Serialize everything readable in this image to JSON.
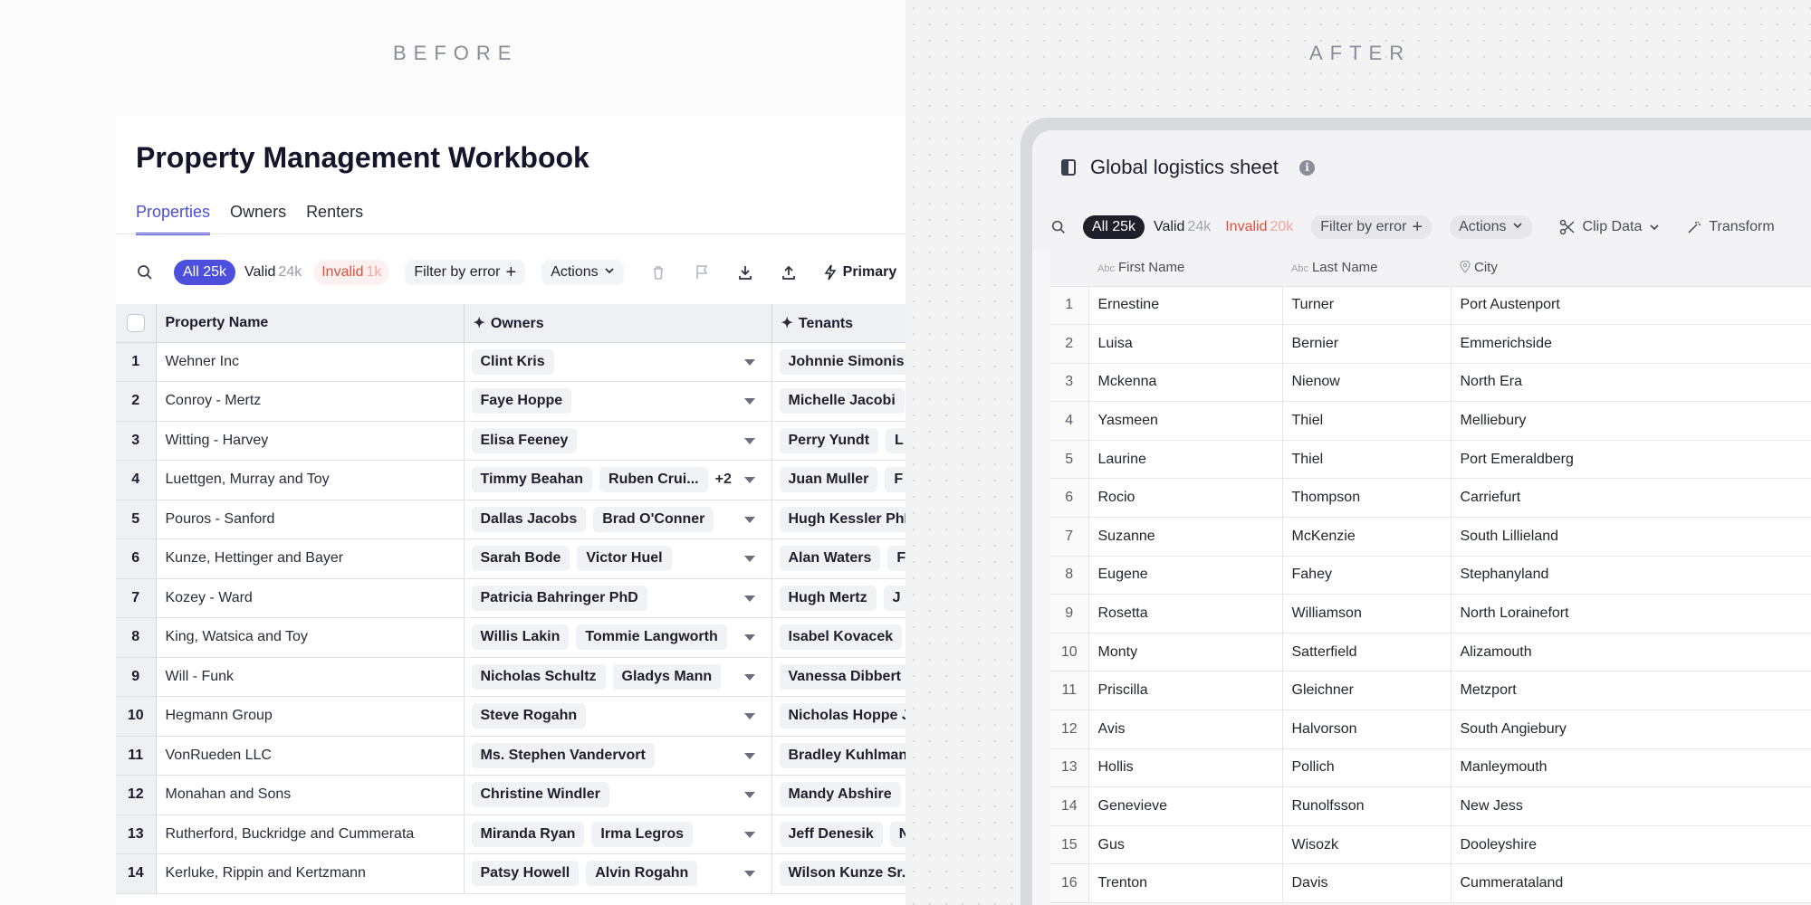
{
  "labels": {
    "before": "BEFORE",
    "after": "AFTER"
  },
  "before": {
    "title": "Property Management Workbook",
    "tabs": [
      {
        "label": "Properties",
        "active": true
      },
      {
        "label": "Owners",
        "active": false
      },
      {
        "label": "Renters",
        "active": false
      }
    ],
    "toolbar": {
      "all_label": "All",
      "all_count": "25k",
      "valid_label": "Valid",
      "valid_count": "24k",
      "invalid_label": "Invalid",
      "invalid_count": "1k",
      "filter_label": "Filter by error",
      "actions_label": "Actions",
      "primary_label": "Primary"
    },
    "columns": [
      "Property Name",
      "Owners",
      "Tenants"
    ],
    "rows": [
      {
        "num": "1",
        "name": "Wehner Inc",
        "owners": [
          "Clint Kris"
        ],
        "more": "",
        "tenants": [
          "Johnnie Simonis"
        ]
      },
      {
        "num": "2",
        "name": "Conroy - Mertz",
        "owners": [
          "Faye Hoppe"
        ],
        "more": "",
        "tenants": [
          "Michelle Jacobi"
        ]
      },
      {
        "num": "3",
        "name": "Witting - Harvey",
        "owners": [
          "Elisa Feeney"
        ],
        "more": "",
        "tenants": [
          "Perry Yundt",
          "L"
        ]
      },
      {
        "num": "4",
        "name": "Luettgen, Murray and Toy",
        "owners": [
          "Timmy Beahan",
          "Ruben Crui..."
        ],
        "more": "+2",
        "tenants": [
          "Juan Muller",
          "F"
        ]
      },
      {
        "num": "5",
        "name": "Pouros - Sanford",
        "owners": [
          "Dallas Jacobs",
          "Brad O'Conner"
        ],
        "more": "",
        "tenants": [
          "Hugh Kessler PhD"
        ]
      },
      {
        "num": "6",
        "name": "Kunze, Hettinger and Bayer",
        "owners": [
          "Sarah Bode",
          "Victor Huel"
        ],
        "more": "",
        "tenants": [
          "Alan Waters",
          "F"
        ]
      },
      {
        "num": "7",
        "name": "Kozey - Ward",
        "owners": [
          "Patricia Bahringer PhD"
        ],
        "more": "",
        "tenants": [
          "Hugh Mertz",
          "J"
        ]
      },
      {
        "num": "8",
        "name": "King, Watsica and Toy",
        "owners": [
          "Willis Lakin",
          "Tommie Langworth"
        ],
        "more": "",
        "tenants": [
          "Isabel Kovacek"
        ]
      },
      {
        "num": "9",
        "name": "Will - Funk",
        "owners": [
          "Nicholas Schultz",
          "Gladys Mann"
        ],
        "more": "",
        "tenants": [
          "Vanessa Dibbert"
        ]
      },
      {
        "num": "10",
        "name": "Hegmann Group",
        "owners": [
          "Steve Rogahn"
        ],
        "more": "",
        "tenants": [
          "Nicholas Hoppe J"
        ]
      },
      {
        "num": "11",
        "name": "VonRueden LLC",
        "owners": [
          "Ms. Stephen Vandervort"
        ],
        "more": "",
        "tenants": [
          "Bradley Kuhlman"
        ]
      },
      {
        "num": "12",
        "name": "Monahan and Sons",
        "owners": [
          "Christine Windler"
        ],
        "more": "",
        "tenants": [
          "Mandy Abshire"
        ]
      },
      {
        "num": "13",
        "name": "Rutherford, Buckridge and Cummerata",
        "owners": [
          "Miranda Ryan",
          "Irma Legros"
        ],
        "more": "",
        "tenants": [
          "Jeff Denesik",
          "N"
        ]
      },
      {
        "num": "14",
        "name": "Kerluke, Rippin and Kertzmann",
        "owners": [
          "Patsy Howell",
          "Alvin Rogahn"
        ],
        "more": "",
        "tenants": [
          "Wilson Kunze Sr."
        ]
      }
    ]
  },
  "after": {
    "title": "Global logistics sheet",
    "toolbar": {
      "all_label": "All",
      "all_count": "25k",
      "valid_label": "Valid",
      "valid_count": "24k",
      "invalid_label": "Invalid",
      "invalid_count": "20k",
      "filter_label": "Filter by error",
      "actions_label": "Actions",
      "clip_label": "Clip Data",
      "transform_label": "Transform"
    },
    "columns": [
      {
        "type": "Abc",
        "label": "First Name"
      },
      {
        "type": "Abc",
        "label": "Last Name"
      },
      {
        "type": "pin",
        "label": "City"
      }
    ],
    "rows": [
      {
        "num": "1",
        "first": "Ernestine",
        "last": "Turner",
        "city": "Port Austenport"
      },
      {
        "num": "2",
        "first": "Luisa",
        "last": "Bernier",
        "city": "Emmerichside"
      },
      {
        "num": "3",
        "first": "Mckenna",
        "last": "Nienow",
        "city": "North Era"
      },
      {
        "num": "4",
        "first": "Yasmeen",
        "last": "Thiel",
        "city": "Melliebury"
      },
      {
        "num": "5",
        "first": "Laurine",
        "last": "Thiel",
        "city": "Port Emeraldberg"
      },
      {
        "num": "6",
        "first": "Rocio",
        "last": "Thompson",
        "city": "Carriefurt"
      },
      {
        "num": "7",
        "first": "Suzanne",
        "last": "McKenzie",
        "city": "South Lillieland"
      },
      {
        "num": "8",
        "first": "Eugene",
        "last": "Fahey",
        "city": "Stephanyland"
      },
      {
        "num": "9",
        "first": "Rosetta",
        "last": "Williamson",
        "city": "North Lorainefort"
      },
      {
        "num": "10",
        "first": "Monty",
        "last": "Satterfield",
        "city": "Alizamouth"
      },
      {
        "num": "11",
        "first": "Priscilla",
        "last": "Gleichner",
        "city": "Metzport"
      },
      {
        "num": "12",
        "first": "Avis",
        "last": "Halvorson",
        "city": "South Angiebury"
      },
      {
        "num": "13",
        "first": "Hollis",
        "last": "Pollich",
        "city": "Manleymouth"
      },
      {
        "num": "14",
        "first": "Genevieve",
        "last": "Runolfsson",
        "city": "New Jess"
      },
      {
        "num": "15",
        "first": "Gus",
        "last": "Wisozk",
        "city": "Dooleyshire"
      },
      {
        "num": "16",
        "first": "Trenton",
        "last": "Davis",
        "city": "Cummerataland"
      }
    ]
  },
  "colors": {
    "accent": "#4c50dc",
    "invalid": "#e0503a",
    "after_pill": "#1e1f2a"
  }
}
